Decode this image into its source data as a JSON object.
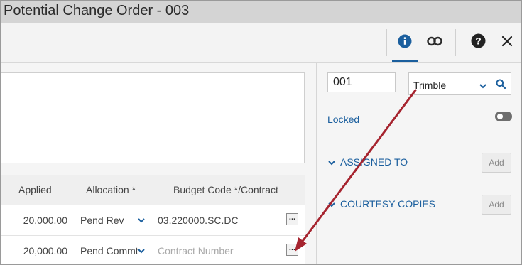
{
  "window": {
    "title": "Potential Change Order - 003"
  },
  "toolbar": {
    "icons": [
      "info-icon",
      "link-icon",
      "help-icon",
      "close-icon"
    ],
    "accent_color": "#1b5f9e"
  },
  "grid": {
    "headers": {
      "applied": "Applied",
      "allocation": "Allocation *",
      "budget": "Budget Code */Contract"
    },
    "rows": [
      {
        "applied": "20,000.00",
        "allocation": "Pend Rev",
        "budget": "03.220000.SC.DC"
      },
      {
        "applied": "20,000.00",
        "allocation": "Pend Commt",
        "budget_placeholder": "Contract Number"
      }
    ],
    "ellipsis_label": "..."
  },
  "details": {
    "number": "001",
    "company": "Trimble",
    "locked_label": "Locked",
    "locked": false,
    "assigned_to": {
      "label": "ASSIGNED TO",
      "add_label": "Add"
    },
    "courtesy_copies": {
      "label": "COURTESY COPIES",
      "add_label": "Add"
    }
  },
  "annotation": {
    "color": "#a6242f"
  }
}
